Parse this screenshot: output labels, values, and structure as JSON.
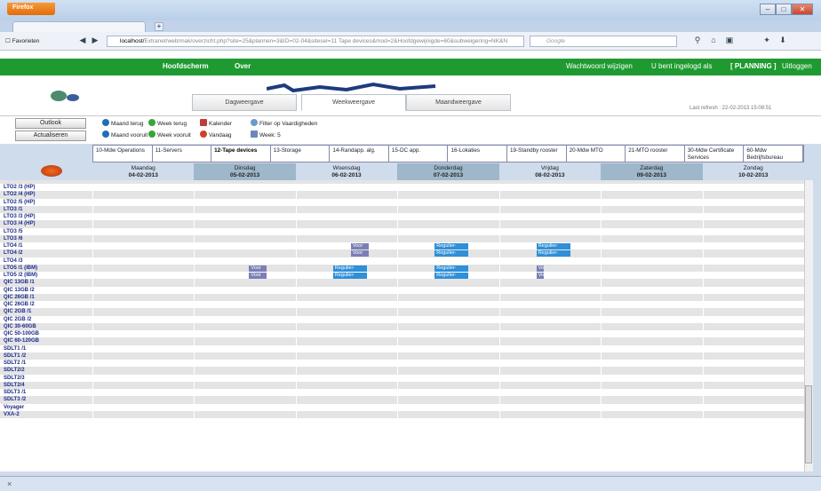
{
  "browser": {
    "app_button": "Firefox",
    "url": "localhost/",
    "url_rest": "Extranet/web/mak/overzicht.php?site=25&plannen=3&ID=02-04&sitesel=11 Tape devices&mod=2&Hoofdgewijnigde=60&subweigering=NK&N",
    "search_placeholder": "Google",
    "bookmarks": "Favorieten"
  },
  "app": {
    "nav": [
      "Hoofdscherm",
      "Over"
    ],
    "right_links": [
      "Wachtwoord wijzigen",
      "U bent ingelogd als",
      "[ PLANNING ]",
      "Uitloggen"
    ],
    "view_tabs": [
      "Dagweergave",
      "Weekweergave",
      "Maandweergave"
    ],
    "active_view": 1,
    "last_refresh": "Last refresh : 22-02-2013 15:08:51"
  },
  "toolbar": {
    "outlook": "Outlook",
    "refresh": "Actualiseren",
    "month_back": "Maand terug",
    "week_back": "Week terug",
    "calendar": "Kalender",
    "filter": "Filter op Vaardigheden",
    "month_forward": "Maand vooruit",
    "week_forward": "Week vooruit",
    "today": "Vandaag",
    "week": "Week: 5"
  },
  "categories": [
    "10-Mdw Operations",
    "11-Servers",
    "12-Tape devices",
    "13-Storage",
    "14-Randapp. alg.",
    "15-DC app.",
    "16-Lokaties",
    "19-Standby rooster",
    "20-Mdw MTO",
    "21-MTO rooster",
    "30-Mdw Certificate Services",
    "60-Mdw Bedrijfsbureau"
  ],
  "active_category": 2,
  "days": [
    {
      "name": "Maandag",
      "date": "04-02-2013"
    },
    {
      "name": "Dinsdag",
      "date": "05-02-2013"
    },
    {
      "name": "Woensdag",
      "date": "06-02-2013"
    },
    {
      "name": "Donderdag",
      "date": "07-02-2013"
    },
    {
      "name": "Vrijdag",
      "date": "08-02-2013"
    },
    {
      "name": "Zaterdag",
      "date": "09-02-2013"
    },
    {
      "name": "Zondag",
      "date": "10-02-2013"
    }
  ],
  "resources": [
    "LTO2 /3 (HP)",
    "LTO2 /4 (HP)",
    "LTO2 /5 (HP)",
    "LTO3 /1",
    "LTO3 /3 (HP)",
    "LTO3 /4 (HP)",
    "LTO3 /5",
    "LTO3 /6",
    "LTO4 /1",
    "LTO4 /2",
    "LTO4 /3",
    "LTO5 /1 (IBM)",
    "LTO5 /2 (IBM)",
    "QIC 13GB /1",
    "QIC 13GB /2",
    "QIC 26GB /1",
    "QIC 26GB /2",
    "QIC 2GB /1",
    "QIC 2GB /2",
    "QIC 30-60GB",
    "QIC 50-100GB",
    "QIC 60-120GB",
    "SDLT1 /1",
    "SDLT1 /2",
    "SDLT2 /1",
    "SDLT2/2",
    "SDLT2/3",
    "SDLT2/4",
    "SDLT3 /1",
    "SDLT3 /2",
    "Voyager",
    "VXA-2"
  ],
  "events": [
    {
      "row": 8,
      "day": 2,
      "label": "Voor",
      "color": "#7b7fb5"
    },
    {
      "row": 8,
      "day": 3,
      "label": "Regulier-",
      "color": "#2f8fd8"
    },
    {
      "row": 8,
      "day": 4,
      "label": "Regulier-",
      "color": "#2f8fd8"
    },
    {
      "row": 9,
      "day": 2,
      "label": "Voor",
      "color": "#7b7fb5"
    },
    {
      "row": 9,
      "day": 3,
      "label": "Regulier-",
      "color": "#2f8fd8"
    },
    {
      "row": 9,
      "day": 4,
      "label": "Regulier-",
      "color": "#2f8fd8"
    },
    {
      "row": 11,
      "day": 1,
      "label": "Voor",
      "color": "#7b7fb5"
    },
    {
      "row": 11,
      "day": 2,
      "label": "Regulier-",
      "color": "#2f8fd8"
    },
    {
      "row": 11,
      "day": 3,
      "label": "Regulier-",
      "color": "#2f8fd8"
    },
    {
      "row": 11,
      "day": 4,
      "label": "Vo",
      "color": "#7b7fb5",
      "short": true
    },
    {
      "row": 12,
      "day": 1,
      "label": "Voor",
      "color": "#7b7fb5"
    },
    {
      "row": 12,
      "day": 2,
      "label": "Regulier-",
      "color": "#2f8fd8"
    },
    {
      "row": 12,
      "day": 3,
      "label": "Regulier-",
      "color": "#2f8fd8"
    },
    {
      "row": 12,
      "day": 4,
      "label": "Vo",
      "color": "#7b7fb5",
      "short": true
    }
  ],
  "status": "×"
}
